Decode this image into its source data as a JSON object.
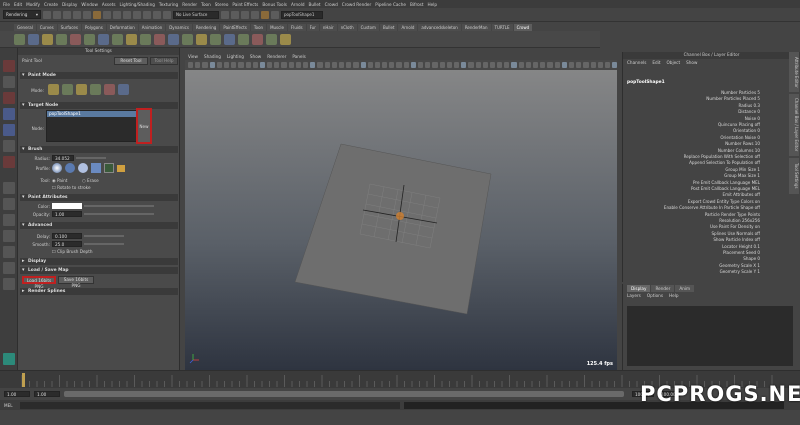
{
  "menubar": {
    "items": [
      "File",
      "Edit",
      "Modify",
      "Create",
      "Display",
      "Window",
      "Assets",
      "Lighting/Shading",
      "Texturing",
      "Render",
      "Toon",
      "Stereo",
      "Paint Effects",
      "Bonus Tools",
      "Arnold",
      "Bullet",
      "Crowd",
      "Crowd Render",
      "Pipeline Cache",
      "Bifrost",
      "Help"
    ]
  },
  "statusline": {
    "mode": "Rendering",
    "render_target": "No Live Surface",
    "selection_field": "popToolShape1"
  },
  "shelf": {
    "tabs": [
      "General",
      "Curves",
      "Surfaces",
      "Polygons",
      "Deformation",
      "Animation",
      "Dynamics",
      "Rendering",
      "PaintEffects",
      "Toon",
      "Muscle",
      "Fluids",
      "Fur",
      "nHair",
      "nCloth",
      "Custom",
      "Bullet",
      "Arnold",
      "advancedskeleton",
      "RenderMan",
      "TURTLE",
      "Crowd"
    ],
    "active_tab": "Crowd"
  },
  "tool_settings": {
    "panel_title": "Tool Settings",
    "tool_name": "Paint Tool",
    "reset_button": "Reset Tool",
    "help_button": "Tool Help",
    "sections": {
      "paint_mode": "Paint Mode",
      "target_node": "Target Node",
      "brush": "Brush",
      "paint_attributes": "Paint Attributes",
      "advanced": "Advanced",
      "display": "Display",
      "load_save_map": "Load / Save Map",
      "render_splines": "Render Splines"
    },
    "mode_label": "Mode:",
    "node_label": "Node:",
    "node_value": "popToolShape1",
    "new_button": "New",
    "radius_label": "Radius:",
    "radius_value": "34.052",
    "profile_label": "Profile:",
    "tool_label": "Tool:",
    "tool_paint": "Paint",
    "tool_erase": "Erase",
    "rotate_to_stroke": "Rotate to stroke",
    "color_label": "Color:",
    "opacity_label": "Opacity:",
    "opacity_value": "1.00",
    "delay_label": "Delay:",
    "delay_value": "0.100",
    "smooth_label": "Smooth:",
    "smooth_value": "25.0",
    "clip_brush_depth": "Clip Brush Depth",
    "load_button": "Load 16bits PNG",
    "save_button": "Save 16bits PNG"
  },
  "viewport": {
    "menu": [
      "View",
      "Shading",
      "Lighting",
      "Show",
      "Renderer",
      "Panels"
    ],
    "fps": "125.4 fps"
  },
  "channel_box": {
    "title": "Channel Box / Layer Editor",
    "menu": [
      "Channels",
      "Edit",
      "Object",
      "Show"
    ],
    "node": "popToolShape1",
    "attributes": [
      "Number Particles 5",
      "Number Particles Placed 5",
      "Radius 0.3",
      "Distance 0",
      "Noise 0",
      "Quincunx Placing off",
      "Orientation 0",
      "Orientation Noise 0",
      "Number Rows 10",
      "Number Columns 10",
      "Replace Population With Selection off",
      "Append Selection To Population off",
      "Group Min Size 1",
      "Group Max Size 1",
      "Pre Emit Callback Language MEL",
      "Post Emit Callback Language MEL",
      "Emit Attributes off",
      "Export Crowd Entity Type Colors on",
      "Enable Conserve Attribute In Particle Shape off",
      "Particle Render Type Points",
      "Resolution 256x256",
      "Use Paint For Density on",
      "Splines Use Normals off",
      "Show Particle Index off",
      "Locator Height 0.1",
      "Placement Seed 0",
      "Shape 0",
      "Geometry Scale X 1",
      "Geometry Scale Y 1"
    ]
  },
  "layer_editor": {
    "tabs": [
      "Display",
      "Render",
      "Anim"
    ],
    "active_tab": "Display",
    "menu": [
      "Layers",
      "Options",
      "Help"
    ]
  },
  "side_tabs": [
    "Attribute Editor",
    "Channel Box / Layer Editor",
    "Tool Settings"
  ],
  "timeline": {
    "start": "1.00",
    "end": "100.00",
    "range_start": "1.00",
    "range_end": "100.00"
  },
  "command_line": {
    "label": "MEL"
  },
  "watermark": "PCPROGS.NET"
}
